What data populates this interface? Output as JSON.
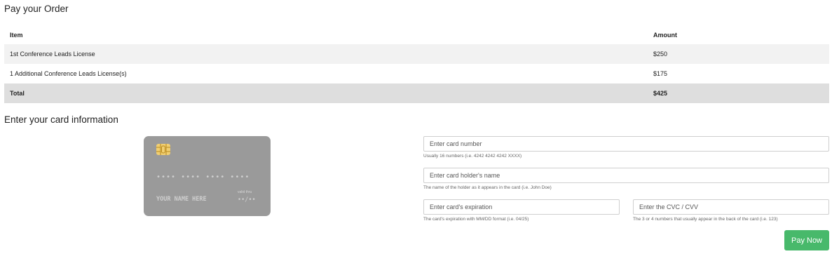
{
  "order": {
    "title": "Pay your Order",
    "columns": {
      "item": "Item",
      "amount": "Amount"
    },
    "rows": [
      {
        "item": "1st Conference Leads License",
        "amount": "$250"
      },
      {
        "item": "1 Additional Conference Leads License(s)",
        "amount": "$175"
      }
    ],
    "total": {
      "label": "Total",
      "amount": "$425"
    }
  },
  "card_section": {
    "title": "Enter your card information",
    "preview": {
      "number": "•••• •••• •••• ••••",
      "name": "YOUR NAME HERE",
      "valid_label": "valid thru",
      "expiry": "••/••"
    },
    "fields": {
      "number": {
        "placeholder": "Enter card number",
        "help": "Usually 16 numbers (i.e. 4242 4242 4242 XXXX)"
      },
      "holder": {
        "placeholder": "Enter card holder's name",
        "help": "The name of the holder as it appears in the card (i.e. John Doe)"
      },
      "expiration": {
        "placeholder": "Enter card's expiration",
        "help": "The card's expiration with MM/DD format (i.e. 04/25)"
      },
      "cvc": {
        "placeholder": "Enter the CVC / CVV",
        "help": "The 3 or 4 numbers that usually appear in the back of the card (i.e. 123)"
      }
    },
    "pay_button": "Pay Now"
  },
  "colors": {
    "card": "#9a9a9a",
    "chip": "#f1cf72",
    "pay_button": "#48b96b",
    "total_row": "#dedede",
    "stripe_row": "#f2f2f2"
  },
  "icons": {
    "chip": "card-chip-icon"
  }
}
